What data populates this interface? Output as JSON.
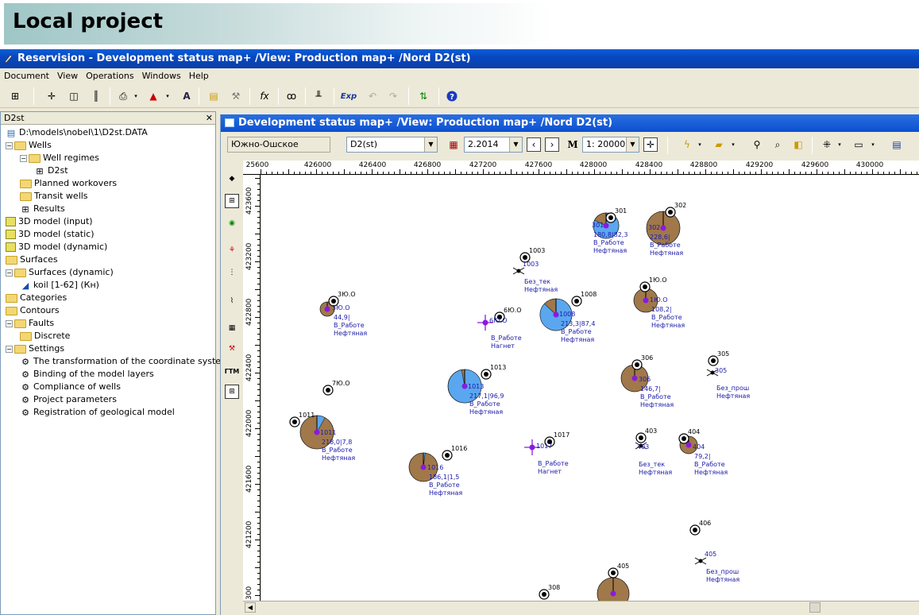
{
  "slide_title": "Local project",
  "app": {
    "title": "Reservision - Development status map+ /View: Production map+ /Nord D2(st)",
    "menu": [
      "Document",
      "View",
      "Operations",
      "Windows",
      "Help"
    ],
    "toolbar_exp_label": "Exp"
  },
  "left_panel": {
    "header": "D2st",
    "close": "✕",
    "tree": [
      {
        "label": "D:\\models\\nobel\\1\\D2st.DATA",
        "depth": 0,
        "toggle": "",
        "icon": "db"
      },
      {
        "label": "Wells",
        "depth": 0,
        "toggle": "−",
        "icon": "folder"
      },
      {
        "label": "Well regimes",
        "depth": 1,
        "toggle": "−",
        "icon": "folder"
      },
      {
        "label": "D2st",
        "depth": 2,
        "toggle": "",
        "icon": "grid"
      },
      {
        "label": "Planned workovers",
        "depth": 1,
        "toggle": "",
        "icon": "folder"
      },
      {
        "label": "Transit wells",
        "depth": 1,
        "toggle": "",
        "icon": "folder"
      },
      {
        "label": "Results",
        "depth": 1,
        "toggle": "",
        "icon": "grid"
      },
      {
        "label": "3D model (input)",
        "depth": 0,
        "toggle": "",
        "icon": "cube"
      },
      {
        "label": "3D model (static)",
        "depth": 0,
        "toggle": "",
        "icon": "cube"
      },
      {
        "label": "3D model (dynamic)",
        "depth": 0,
        "toggle": "",
        "icon": "cube"
      },
      {
        "label": "Surfaces",
        "depth": 0,
        "toggle": "",
        "icon": "folder"
      },
      {
        "label": "Surfaces (dynamic)",
        "depth": 0,
        "toggle": "−",
        "icon": "folder"
      },
      {
        "label": "koil [1-62] (Кн)",
        "depth": 1,
        "toggle": "",
        "icon": "surf"
      },
      {
        "label": "Categories",
        "depth": 0,
        "toggle": "",
        "icon": "folder"
      },
      {
        "label": "Contours",
        "depth": 0,
        "toggle": "",
        "icon": "folder"
      },
      {
        "label": "Faults",
        "depth": 0,
        "toggle": "−",
        "icon": "folder"
      },
      {
        "label": "Discrete",
        "depth": 1,
        "toggle": "",
        "icon": "folder"
      },
      {
        "label": "Settings",
        "depth": 0,
        "toggle": "−",
        "icon": "folder"
      },
      {
        "label": "The transformation of the coordinate syste",
        "depth": 1,
        "toggle": "",
        "icon": "set"
      },
      {
        "label": "Binding of the model layers",
        "depth": 1,
        "toggle": "",
        "icon": "set"
      },
      {
        "label": "Compliance of wells",
        "depth": 1,
        "toggle": "",
        "icon": "set"
      },
      {
        "label": "Project parameters",
        "depth": 1,
        "toggle": "",
        "icon": "set"
      },
      {
        "label": "Registration of geological model",
        "depth": 1,
        "toggle": "",
        "icon": "set"
      }
    ]
  },
  "map_window": {
    "title": "Development status map+ /View: Production map+ /Nord D2(st)",
    "field_name": "Южно-Ошское",
    "layer": "D2(st)",
    "date": "2.2014",
    "scale_prefix": "1:",
    "scale": "20000",
    "x_ticks": [
      "25600",
      "426000",
      "426400",
      "426800",
      "427200",
      "427600",
      "428000",
      "428400",
      "428800",
      "429200",
      "429600",
      "430000"
    ],
    "y_ticks": [
      "423600",
      "423200",
      "422800",
      "422400",
      "422000",
      "421600",
      "421200",
      "300"
    ],
    "wells": [
      {
        "id": "301",
        "sub": "301",
        "vals": "180,8|82,3",
        "status": "В_Работе",
        "type": "Нефтяная",
        "kind": "blue"
      },
      {
        "id": "302",
        "sub": "302",
        "vals": "228,6|",
        "status": "В_Работе",
        "type": "Нефтяная",
        "kind": "brown"
      },
      {
        "id": "1003",
        "sub": "1003",
        "vals": "",
        "status": "Без_тек",
        "type": "Нефтяная",
        "kind": "idle"
      },
      {
        "id": "1Ю.О",
        "sub": "1Ю.О",
        "vals": "108,2|",
        "status": "В_Работе",
        "type": "Нефтяная",
        "kind": "brown"
      },
      {
        "id": "1008",
        "sub": "1008",
        "vals": "213,3|87,4",
        "status": "В_Работе",
        "type": "Нефтяная",
        "kind": "blue"
      },
      {
        "id": "3Ю.О",
        "sub": "3Ю.О",
        "vals": "44,9|",
        "status": "В_Работе",
        "type": "Нефтяная",
        "kind": "brown"
      },
      {
        "id": "6Ю.О",
        "sub": "6Ю.О",
        "vals": "",
        "status": "В_Работе",
        "type": "Нагнет",
        "kind": "inj"
      },
      {
        "id": "306",
        "sub": "306",
        "vals": "146,7|",
        "status": "В_Работе",
        "type": "Нефтяная",
        "kind": "brown"
      },
      {
        "id": "305",
        "sub": "305",
        "vals": "",
        "status": "Без_прош",
        "type": "Нефтяная",
        "kind": "idle"
      },
      {
        "id": "1013",
        "sub": "1013",
        "vals": "217,1|96,9",
        "status": "В_Работе",
        "type": "Нефтяная",
        "kind": "blue"
      },
      {
        "id": "7Ю.О",
        "sub": "",
        "vals": "",
        "status": "",
        "type": "",
        "kind": "plain"
      },
      {
        "id": "1011",
        "sub": "1011",
        "vals": "218,0|7,8",
        "status": "В_Работе",
        "type": "Нефтяная",
        "kind": "brown"
      },
      {
        "id": "1017",
        "sub": "1017",
        "vals": "",
        "status": "В_Работе",
        "type": "Нагнет",
        "kind": "inj"
      },
      {
        "id": "403",
        "sub": "403",
        "vals": "",
        "status": "Без_тек",
        "type": "Нефтяная",
        "kind": "idle"
      },
      {
        "id": "404",
        "sub": "404",
        "vals": "79,2|",
        "status": "В_Работе",
        "type": "Нефтяная",
        "kind": "brown"
      },
      {
        "id": "1016",
        "sub": "1016",
        "vals": "186,1|1,5",
        "status": "В_Работе",
        "type": "Нефтяная",
        "kind": "brown"
      },
      {
        "id": "406",
        "sub": "",
        "vals": "",
        "status": "",
        "type": "",
        "kind": "plain"
      },
      {
        "id": "405",
        "sub": "405",
        "vals": "",
        "status": "Без_прош",
        "type": "Нефтяная",
        "kind": "idle"
      },
      {
        "id": "308",
        "sub": "",
        "vals": "",
        "status": "",
        "type": "",
        "kind": "plain"
      },
      {
        "id": "405",
        "sub": "405",
        "vals": "",
        "status": "",
        "type": "",
        "kind": "brown"
      }
    ]
  },
  "colors": {
    "oil": "#a0784a",
    "water": "#5aa7f0",
    "label": "#1a1aaa",
    "bubble_center": "#8a1ae0",
    "title_blue": "#0a4fc8"
  }
}
